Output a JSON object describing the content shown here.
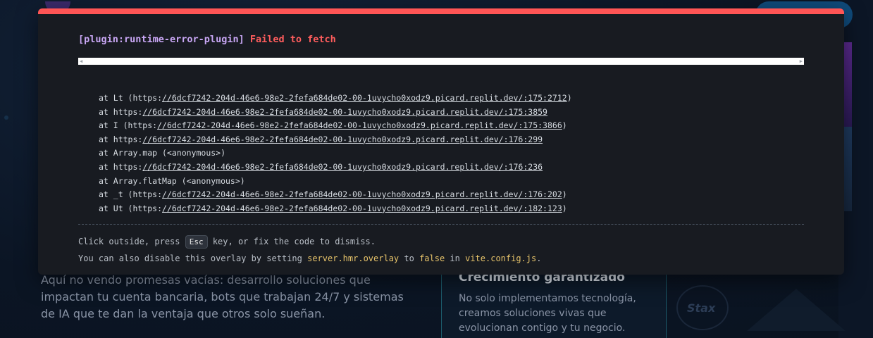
{
  "background": {
    "lead_text": "Aquí no vendo promesas vacías: desarrollo soluciones que impactan tu cuenta bancaria, bots que trabajan 24/7 y sistemas de IA que te dan la ventaja que otros solo sueñan.",
    "card_title": "Crecimiento garantizado",
    "card_text": "No solo implementamos tecnología, creamos soluciones vivas que evolucionan contigo y tu negocio.",
    "logo_text": "Stax"
  },
  "overlay": {
    "plugin": "[plugin:runtime-error-plugin]",
    "message": "Failed to fetch",
    "stack": [
      {
        "prefix": "at Lt (https:",
        "link": "//6dcf7242-204d-46e6-98e2-2fefa684de02-00-1uvycho0xodz9.picard.replit.dev/:175:2712",
        "suffix": ")"
      },
      {
        "prefix": "at https:",
        "link": "//6dcf7242-204d-46e6-98e2-2fefa684de02-00-1uvycho0xodz9.picard.replit.dev/:175:3859",
        "suffix": ""
      },
      {
        "prefix": "at I (https:",
        "link": "//6dcf7242-204d-46e6-98e2-2fefa684de02-00-1uvycho0xodz9.picard.replit.dev/:175:3866",
        "suffix": ")"
      },
      {
        "prefix": "at https:",
        "link": "//6dcf7242-204d-46e6-98e2-2fefa684de02-00-1uvycho0xodz9.picard.replit.dev/:176:299",
        "suffix": ""
      },
      {
        "prefix": "at Array.map (<anonymous>)",
        "link": "",
        "suffix": ""
      },
      {
        "prefix": "at https:",
        "link": "//6dcf7242-204d-46e6-98e2-2fefa684de02-00-1uvycho0xodz9.picard.replit.dev/:176:236",
        "suffix": ""
      },
      {
        "prefix": "at Array.flatMap (<anonymous>)",
        "link": "",
        "suffix": ""
      },
      {
        "prefix": "at _t (https:",
        "link": "//6dcf7242-204d-46e6-98e2-2fefa684de02-00-1uvycho0xodz9.picard.replit.dev/:176:202",
        "suffix": ")"
      },
      {
        "prefix": "at Ut (https:",
        "link": "//6dcf7242-204d-46e6-98e2-2fefa684de02-00-1uvycho0xodz9.picard.replit.dev/:182:123",
        "suffix": ")"
      }
    ],
    "tip1_before": "Click outside, press ",
    "tip1_key": "Esc",
    "tip1_after": " key, or fix the code to dismiss.",
    "tip2_before": "You can also disable this overlay by setting ",
    "tip2_setting": "server.hmr.overlay",
    "tip2_middle": " to ",
    "tip2_value": "false",
    "tip2_in": " in ",
    "tip2_file": "vite.config.js",
    "tip2_end": "."
  },
  "colors": {
    "accent_red": "#ff5555",
    "plugin_purple": "#c9a7f5",
    "code_yellow": "#e6c36a"
  },
  "icons": {
    "scroll_left": "scroll-left-arrow-icon",
    "scroll_right": "scroll-right-arrow-icon"
  }
}
